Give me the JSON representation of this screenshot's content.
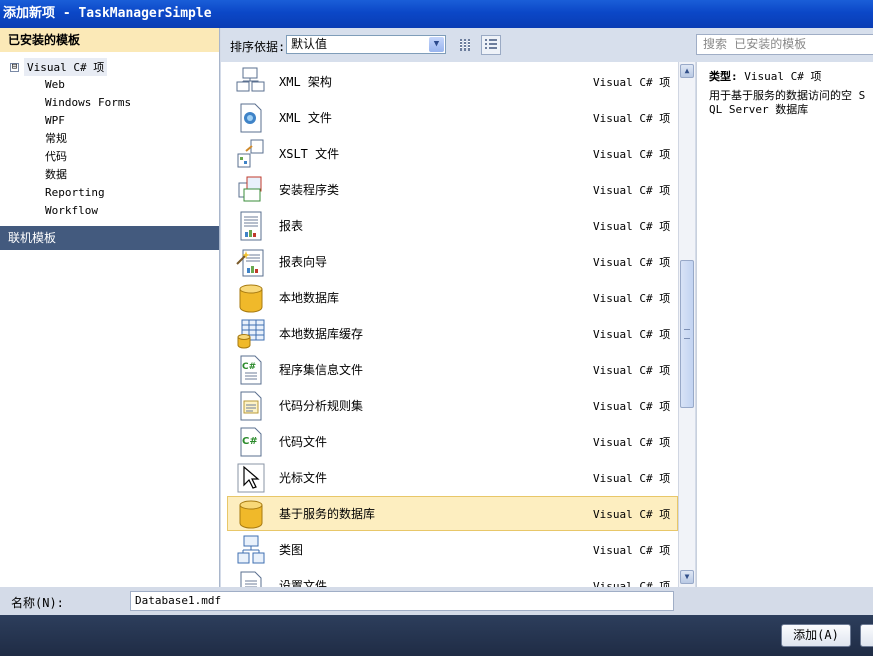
{
  "window": {
    "title": "添加新项 - TaskManagerSimple"
  },
  "left_pane": {
    "installed_header": "已安装的模板",
    "root": {
      "expander": "⊟",
      "label": "Visual C# 项"
    },
    "children": [
      "Web",
      "Windows Forms",
      "WPF",
      "常规",
      "代码",
      "数据",
      "Reporting",
      "Workflow"
    ],
    "online_header": "联机模板"
  },
  "toolbar": {
    "sort_label": "排序依据:",
    "sort_value": "默认值",
    "search_placeholder": "搜索 已安装的模板"
  },
  "items": [
    {
      "name": "XML 架构",
      "type": "Visual C# 项",
      "icon": "xml-schema-icon"
    },
    {
      "name": "XML 文件",
      "type": "Visual C# 项",
      "icon": "xml-file-icon"
    },
    {
      "name": "XSLT 文件",
      "type": "Visual C# 项",
      "icon": "xslt-file-icon"
    },
    {
      "name": "安装程序类",
      "type": "Visual C# 项",
      "icon": "installer-class-icon"
    },
    {
      "name": "报表",
      "type": "Visual C# 项",
      "icon": "report-icon"
    },
    {
      "name": "报表向导",
      "type": "Visual C# 项",
      "icon": "report-wizard-icon"
    },
    {
      "name": "本地数据库",
      "type": "Visual C# 项",
      "icon": "local-database-icon"
    },
    {
      "name": "本地数据库缓存",
      "type": "Visual C# 项",
      "icon": "local-database-cache-icon"
    },
    {
      "name": "程序集信息文件",
      "type": "Visual C# 项",
      "icon": "assembly-info-icon"
    },
    {
      "name": "代码分析规则集",
      "type": "Visual C# 项",
      "icon": "ruleset-icon"
    },
    {
      "name": "代码文件",
      "type": "Visual C# 项",
      "icon": "code-file-icon"
    },
    {
      "name": "光标文件",
      "type": "Visual C# 项",
      "icon": "cursor-file-icon"
    },
    {
      "name": "基于服务的数据库",
      "type": "Visual C# 项",
      "icon": "service-database-icon",
      "selected": true
    },
    {
      "name": "类图",
      "type": "Visual C# 项",
      "icon": "class-diagram-icon"
    },
    {
      "name": "设置文件",
      "type": "Visual C# 项",
      "icon": "settings-file-icon"
    }
  ],
  "details": {
    "type_label": "类型:",
    "type_value": "Visual C# 项",
    "description": "用于基于服务的数据访问的空 SQL Server 数据库"
  },
  "name_field": {
    "label": "名称(N):",
    "value": "Database1.mdf"
  },
  "buttons": {
    "add": "添加(A)"
  },
  "colors": {
    "title_bar": "#0b47c7",
    "selected_item": "#fdeec0",
    "online_header": "#435a7e",
    "installed_header": "#fbe9b7"
  }
}
